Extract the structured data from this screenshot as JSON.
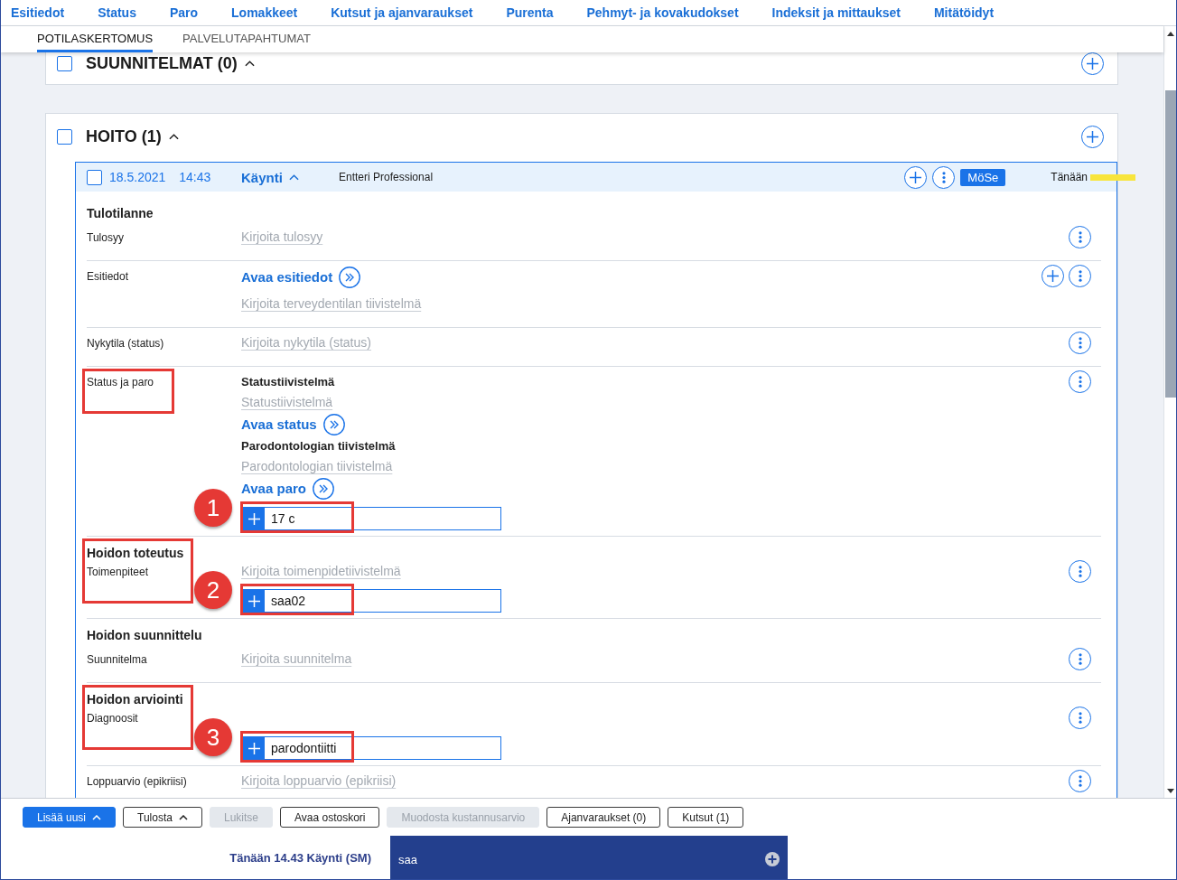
{
  "nav": [
    "Esitiedot",
    "Status",
    "Paro",
    "Lomakkeet",
    "Kutsut ja ajanvaraukset",
    "Purenta",
    "Pehmyt- ja kovakudokset",
    "Indeksit ja mittaukset",
    "Mitätöidyt"
  ],
  "tabs": [
    {
      "label": "POTILASKERTOMUS",
      "selected": true
    },
    {
      "label": "PALVELUTAPAHTUMAT",
      "selected": false
    }
  ],
  "sections": [
    {
      "title": "SUUNNITELMAT (0)",
      "checked": false,
      "expanded": true
    },
    {
      "title": "HOITO (1)",
      "checked": false,
      "expanded": true,
      "visits": [
        {
          "checked": false,
          "date": "18.5.2021",
          "time": "14:43",
          "type": "Käynti",
          "expanded": true,
          "author": "Entteri Professional",
          "initials": "MöSe",
          "day": "Tänään",
          "rows": [
            {
              "heading": "Tulotilanne",
              "label": "Tulosyy",
              "framed": false,
              "add_button": false,
              "items": [
                {
                  "kind": "text-field",
                  "placeholder": "Kirjoita tulosyy"
                }
              ]
            },
            {
              "label": "Esitiedot",
              "framed": false,
              "add_button": true,
              "items": [
                {
                  "kind": "link",
                  "text": "Avaa esitiedot"
                },
                {
                  "kind": "text-field",
                  "placeholder": "Kirjoita terveydentilan tiivistelmä"
                }
              ]
            },
            {
              "label": "Nykytila (status)",
              "framed": false,
              "add_button": false,
              "items": [
                {
                  "kind": "text-field",
                  "placeholder": "Kirjoita nykytila (status)"
                }
              ]
            },
            {
              "label": "Status ja paro",
              "framed": true,
              "add_button": false,
              "items": [
                {
                  "kind": "title",
                  "text": "Statustiivistelmä"
                },
                {
                  "kind": "text-field",
                  "placeholder": "Statustiivistelmä"
                },
                {
                  "kind": "link",
                  "text": "Avaa status"
                },
                {
                  "kind": "title",
                  "text": "Parodontologian tiivistelmä"
                },
                {
                  "kind": "text-field",
                  "placeholder": "Parodontologian tiivistelmä"
                },
                {
                  "kind": "link",
                  "text": "Avaa paro"
                },
                {
                  "kind": "code-input",
                  "value": "17 c",
                  "framed": true,
                  "marker": "1"
                }
              ]
            },
            {
              "heading": "Hoidon toteutus",
              "label": "Toimenpiteet",
              "framed": true,
              "add_button": false,
              "items": [
                {
                  "kind": "text-field",
                  "placeholder": "Kirjoita toimenpidetiivistelmä"
                },
                {
                  "kind": "code-input",
                  "value": "saa02",
                  "framed": true,
                  "marker": "2"
                }
              ]
            },
            {
              "heading": "Hoidon suunnittelu",
              "label": "Suunnitelma",
              "framed": false,
              "add_button": false,
              "items": [
                {
                  "kind": "text-field",
                  "placeholder": "Kirjoita suunnitelma"
                }
              ]
            },
            {
              "heading": "Hoidon arviointi",
              "label": "Diagnoosit",
              "framed": true,
              "add_button": false,
              "items": [
                {
                  "kind": "code-input",
                  "value": "parodontiitti",
                  "framed": true,
                  "marker": "3"
                }
              ]
            },
            {
              "label": "Loppuarvio (epikriisi)",
              "framed": false,
              "add_button": false,
              "items": [
                {
                  "kind": "text-field",
                  "placeholder": "Kirjoita loppuarvio (epikriisi)"
                }
              ]
            }
          ]
        }
      ]
    }
  ],
  "toolbar": [
    {
      "label": "Lisää uusi",
      "kind": "primary",
      "menu": true,
      "disabled": false
    },
    {
      "label": "Tulosta",
      "kind": "secondary",
      "menu": true,
      "disabled": false
    },
    {
      "label": "Lukitse",
      "kind": "secondary",
      "menu": false,
      "disabled": true
    },
    {
      "label": "Avaa ostoskori",
      "kind": "secondary",
      "menu": false,
      "disabled": false
    },
    {
      "label": "Muodosta kustannusarvio",
      "kind": "secondary",
      "menu": false,
      "disabled": true
    },
    {
      "label": "Ajanvaraukset (0)",
      "kind": "secondary",
      "menu": false,
      "disabled": false
    },
    {
      "label": "Kutsut (1)",
      "kind": "secondary",
      "menu": false,
      "disabled": false
    }
  ],
  "status_bar": {
    "summary": "Tänään 14.43 Käynti (SM)",
    "entry": {
      "value": "saa"
    }
  }
}
